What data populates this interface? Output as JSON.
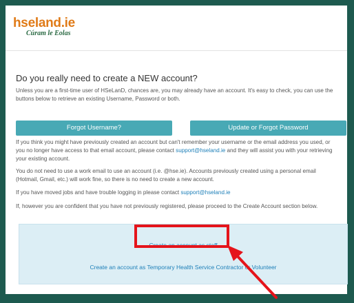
{
  "logo": {
    "main": "hseland.ie",
    "sub": "Cúram le Eolas"
  },
  "heading": "Do you really need to create a NEW account?",
  "intro": "Unless you are a first-time user of HSeLanD, chances are, you may already have an account. It's easy to check, you can use the buttons below to retrieve an existing Username, Password or both.",
  "buttons": {
    "forgot_username": "Forgot Username?",
    "forgot_password": "Update or Forgot Password"
  },
  "para_contact": {
    "before": "If you think you might have previously created an account but can't remember your username or the email address you used, or you no longer have access to that email account, please contact ",
    "email": "support@hseland.ie",
    "after": " and they will assist you with your retrieving your existing account."
  },
  "para_work_email": "You do not need to use a work email to use an account (i.e. @hse.ie). Accounts previously created using a personal email (Hotmail, Gmail, etc.) will work fine, so there is no need to create a new account.",
  "para_moved": {
    "before": "If you have moved jobs and have trouble logging in please contact ",
    "email": "support@hseland.ie"
  },
  "para_confident": "If, however you are confident that you have not previously registered, please proceed to the Create Account section below.",
  "create": {
    "staff": "Create an account as staff",
    "temporary": "Create an account as Temporary Health Service Contractor or Volunteer"
  },
  "colors": {
    "frame": "#1d5a4f",
    "button": "#48a9b5",
    "link": "#1d7fb8",
    "panel": "#dceef5",
    "annotation": "#e5141b",
    "logo_orange": "#e07b18",
    "logo_green": "#2a6a43"
  }
}
